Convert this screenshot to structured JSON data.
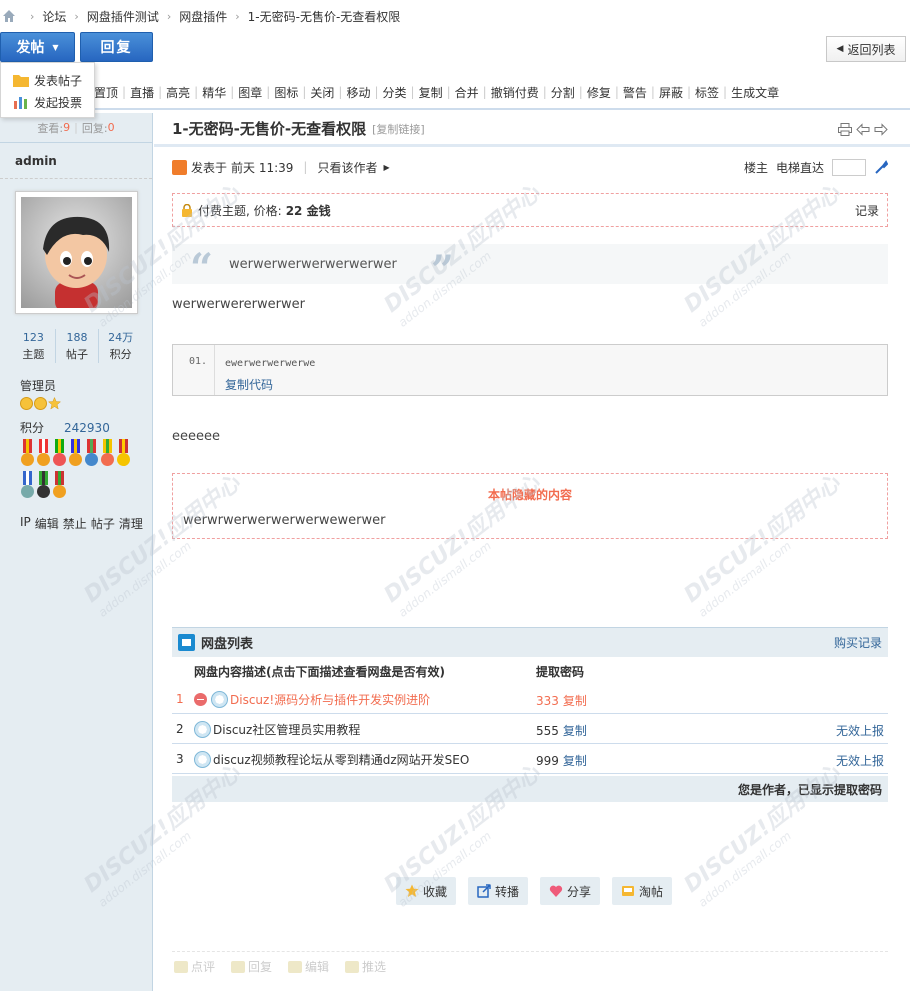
{
  "breadcrumb": [
    "论坛",
    "网盘插件测试",
    "网盘插件",
    "1-无密码-无售价-无查看权限"
  ],
  "buttons": {
    "post": "发帖",
    "reply": "回复",
    "back": "返回列表"
  },
  "dropdown": [
    "发表帖子",
    "发起投票"
  ],
  "mod_tools": [
    "置顶",
    "直播",
    "高亮",
    "精华",
    "图章",
    "图标",
    "关闭",
    "移动",
    "分类",
    "复制",
    "合并",
    "撤销付费",
    "分割",
    "修复",
    "警告",
    "屏蔽",
    "标签",
    "生成文章"
  ],
  "stats": {
    "views_label": "查看:",
    "views": "9",
    "replies_label": "回复:",
    "replies": "0"
  },
  "user": {
    "name": "admin",
    "topics": "123",
    "topics_label": "主题",
    "posts": "188",
    "posts_label": "帖子",
    "credits": "24万",
    "credits_label": "积分",
    "group": "管理员",
    "credit_label": "积分",
    "credit_value": "242930",
    "actions": [
      "IP",
      "编辑",
      "禁止",
      "帖子",
      "清理"
    ]
  },
  "thread": {
    "title": "1-无密码-无售价-无查看权限",
    "copy_link": "[复制链接]",
    "posted_label": "发表于",
    "posted_time": "前天 11:39",
    "only_author": "只看该作者",
    "floor": "楼主",
    "jump_label": "电梯直达"
  },
  "pay": {
    "label": "付费主题, 价格:",
    "price": "22 金钱",
    "record": "记录"
  },
  "quote_text": "werwerwerwerwerwerwer",
  "para1": "werwerwererwerwer",
  "code": {
    "line_no": "01.",
    "content": "ewerwerwerwerwe",
    "copy": "复制代码"
  },
  "para2": "eeeeee",
  "hidden": {
    "title": "本帖隐藏的内容",
    "content": "werwrwerwerwerwerwewerwer"
  },
  "netdisk": {
    "title": "网盘列表",
    "buy_record": "购买记录",
    "col_desc": "网盘内容描述(点击下面描述查看网盘是否有效)",
    "col_pass": "提取密码",
    "copy_label": "复制",
    "rows": [
      {
        "no": "1",
        "desc": "Discuz!源码分析与插件开发实例进阶",
        "pass": "333",
        "report": "",
        "deleted": true
      },
      {
        "no": "2",
        "desc": "Discuz社区管理员实用教程",
        "pass": "555",
        "report": "无效上报",
        "deleted": false
      },
      {
        "no": "3",
        "desc": "discuz视频教程论坛从零到精通dz网站开发SEO",
        "pass": "999",
        "report": "无效上报",
        "deleted": false
      }
    ],
    "footer": "您是作者，已显示提取密码"
  },
  "post_actions": [
    "收藏",
    "转播",
    "分享",
    "淘帖"
  ],
  "bottom_actions": [
    "点评",
    "回复",
    "编辑",
    "推选"
  ],
  "watermark": {
    "main": "DISCUZ!应用中心",
    "sub": "addon.dismall.com"
  },
  "colors": {
    "accent": "#2766c0",
    "link": "#336699",
    "alert": "#f26c4f",
    "panel": "#e5edf2"
  }
}
